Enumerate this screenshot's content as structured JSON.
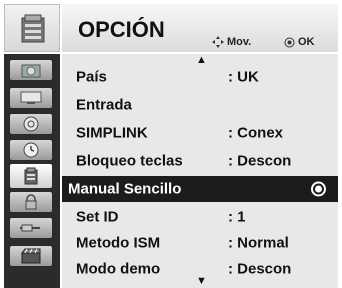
{
  "header": {
    "title": "OPCIÓN",
    "mov_label": "Mov.",
    "ok_label": "OK"
  },
  "sidebar": {
    "icons": [
      "picture-icon",
      "monitor-icon",
      "disc-icon",
      "clock-icon",
      "option-icon",
      "lock-icon",
      "connector-icon",
      "movie-icon"
    ]
  },
  "menu": {
    "items": [
      {
        "label": "País",
        "value": ": UK"
      },
      {
        "label": "Entrada",
        "value": ""
      },
      {
        "label": "SIMPLINK",
        "value": ": Conex"
      },
      {
        "label": "Bloqueo teclas",
        "value": ": Descon"
      },
      {
        "label": "Manual Sencillo",
        "value": ""
      },
      {
        "label": "Set ID",
        "value": ": 1"
      },
      {
        "label": "Metodo ISM",
        "value": ": Normal"
      },
      {
        "label": "Modo demo",
        "value": ": Descon"
      }
    ],
    "selected_index": 4
  },
  "colors": {
    "selected_bg": "#1c1c1c",
    "list_bg": "#e8e8e8",
    "sidebar_bg": "#2b2b2b"
  }
}
